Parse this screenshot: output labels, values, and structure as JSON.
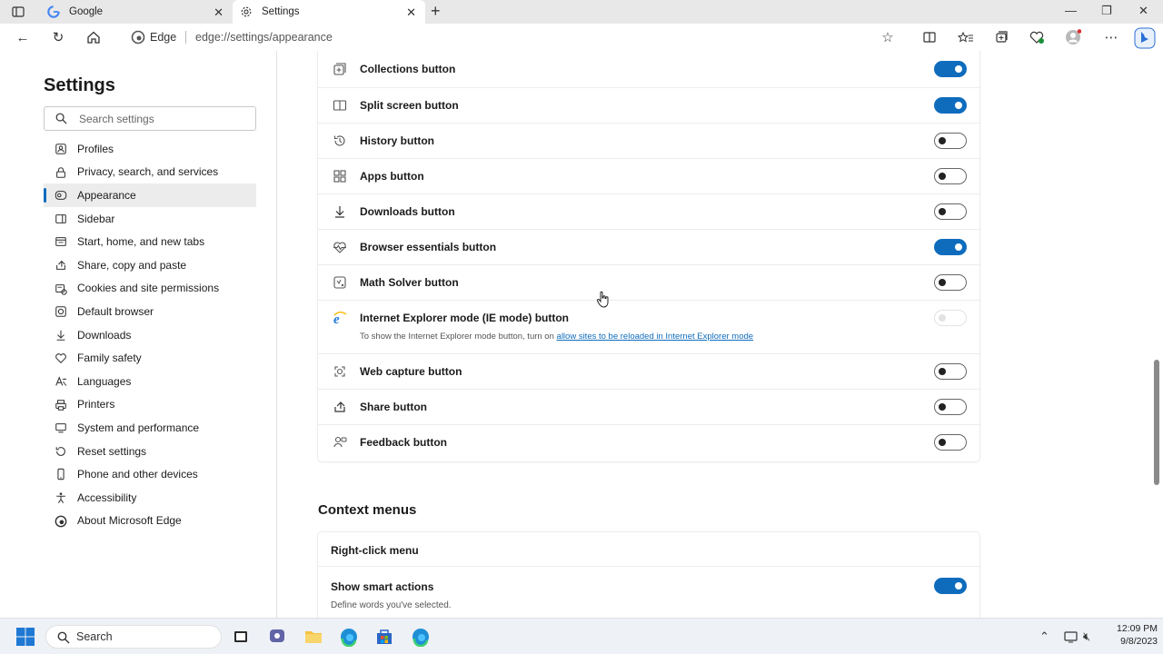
{
  "browser": {
    "tabs": [
      {
        "title": "Google",
        "icon": "google-icon"
      },
      {
        "title": "Settings",
        "icon": "gear-icon"
      }
    ],
    "site_name": "Edge",
    "url": "edge://settings/appearance"
  },
  "sidebar": {
    "title": "Settings",
    "search_placeholder": "Search settings",
    "items": [
      {
        "label": "Profiles",
        "icon": "profile-icon"
      },
      {
        "label": "Privacy, search, and services",
        "icon": "lock-icon"
      },
      {
        "label": "Appearance",
        "icon": "appearance-icon",
        "active": true
      },
      {
        "label": "Sidebar",
        "icon": "sidebar-icon"
      },
      {
        "label": "Start, home, and new tabs",
        "icon": "home-tabs-icon"
      },
      {
        "label": "Share, copy and paste",
        "icon": "share-icon"
      },
      {
        "label": "Cookies and site permissions",
        "icon": "cookies-icon"
      },
      {
        "label": "Default browser",
        "icon": "default-browser-icon"
      },
      {
        "label": "Downloads",
        "icon": "download-icon"
      },
      {
        "label": "Family safety",
        "icon": "family-icon"
      },
      {
        "label": "Languages",
        "icon": "languages-icon"
      },
      {
        "label": "Printers",
        "icon": "printer-icon"
      },
      {
        "label": "System and performance",
        "icon": "system-icon"
      },
      {
        "label": "Reset settings",
        "icon": "reset-icon"
      },
      {
        "label": "Phone and other devices",
        "icon": "phone-icon"
      },
      {
        "label": "Accessibility",
        "icon": "accessibility-icon"
      },
      {
        "label": "About Microsoft Edge",
        "icon": "edge-icon"
      }
    ]
  },
  "toolbar_buttons": {
    "rows": [
      {
        "label": "Collections button",
        "icon": "collections-icon",
        "on": true
      },
      {
        "label": "Split screen button",
        "icon": "split-screen-icon",
        "on": true
      },
      {
        "label": "History button",
        "icon": "history-icon",
        "on": false
      },
      {
        "label": "Apps button",
        "icon": "apps-icon",
        "on": false
      },
      {
        "label": "Downloads button",
        "icon": "download-icon",
        "on": false
      },
      {
        "label": "Browser essentials button",
        "icon": "heart-pulse-icon",
        "on": true
      },
      {
        "label": "Math Solver button",
        "icon": "math-solver-icon",
        "on": false
      },
      {
        "label": "Internet Explorer mode (IE mode) button",
        "icon": "ie-icon",
        "on": false,
        "disabled": true,
        "sub_text": "To show the Internet Explorer mode button, turn on",
        "sub_link": "allow sites to be reloaded in Internet Explorer mode"
      },
      {
        "label": "Web capture button",
        "icon": "web-capture-icon",
        "on": false
      },
      {
        "label": "Share button",
        "icon": "share-icon",
        "on": false
      },
      {
        "label": "Feedback button",
        "icon": "feedback-icon",
        "on": false
      }
    ]
  },
  "context_menus": {
    "title": "Context menus",
    "subsection": "Right-click menu",
    "smart_actions_label": "Show smart actions",
    "smart_actions_sub": "Define words you've selected.",
    "smart_actions_on": true
  },
  "taskbar": {
    "search_label": "Search",
    "time": "12:09 PM",
    "date": "9/8/2023"
  },
  "colors": {
    "accent": "#0f6cbd"
  }
}
